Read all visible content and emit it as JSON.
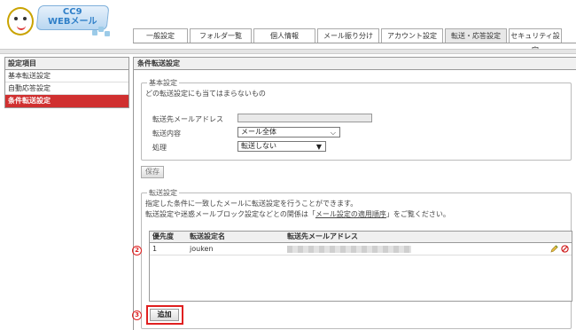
{
  "logo": {
    "line1": "CC9",
    "line2": "WEBメール"
  },
  "tabs": [
    {
      "label": "一般設定"
    },
    {
      "label": "フォルダ一覧"
    },
    {
      "label": "個人情報"
    },
    {
      "label": "メール振り分け"
    },
    {
      "label": "アカウント設定"
    },
    {
      "label": "転送・応答設定",
      "active": true
    },
    {
      "label": "セキュリティ設定"
    }
  ],
  "sidebar": {
    "title": "設定項目",
    "items": [
      {
        "label": "基本転送設定"
      },
      {
        "label": "自動応答設定"
      },
      {
        "label": "条件転送設定",
        "active": true
      }
    ]
  },
  "main": {
    "title": "条件転送設定",
    "basic": {
      "legend": "基本設定",
      "description": "どの転送設定にも当てはまらないもの",
      "fields": {
        "forward_address_label": "転送先メールアドレス",
        "forward_address_value": "",
        "content_label": "転送内容",
        "content_value": "メール全体",
        "action_label": "処理",
        "action_value": "転送しない"
      },
      "save_label": "保存"
    },
    "forward": {
      "legend": "転送設定",
      "help_line1": "指定した条件に一致したメールに転送設定を行うことができます。",
      "help_line2_pre": "転送設定や迷惑メールブロック設定などとの関係は「",
      "help_link": "メール設定の適用順序",
      "help_line2_post": "」をご覧ください。",
      "table": {
        "headers": {
          "priority": "優先度",
          "name": "転送設定名",
          "address": "転送先メールアドレス"
        },
        "rows": [
          {
            "priority": "1",
            "name": "jouken",
            "address": ""
          }
        ]
      },
      "add_label": "追加"
    },
    "markers": {
      "table": "2",
      "add": "3"
    }
  },
  "colors": {
    "active_sidebar": "#d03030",
    "marker": "#e02020"
  }
}
